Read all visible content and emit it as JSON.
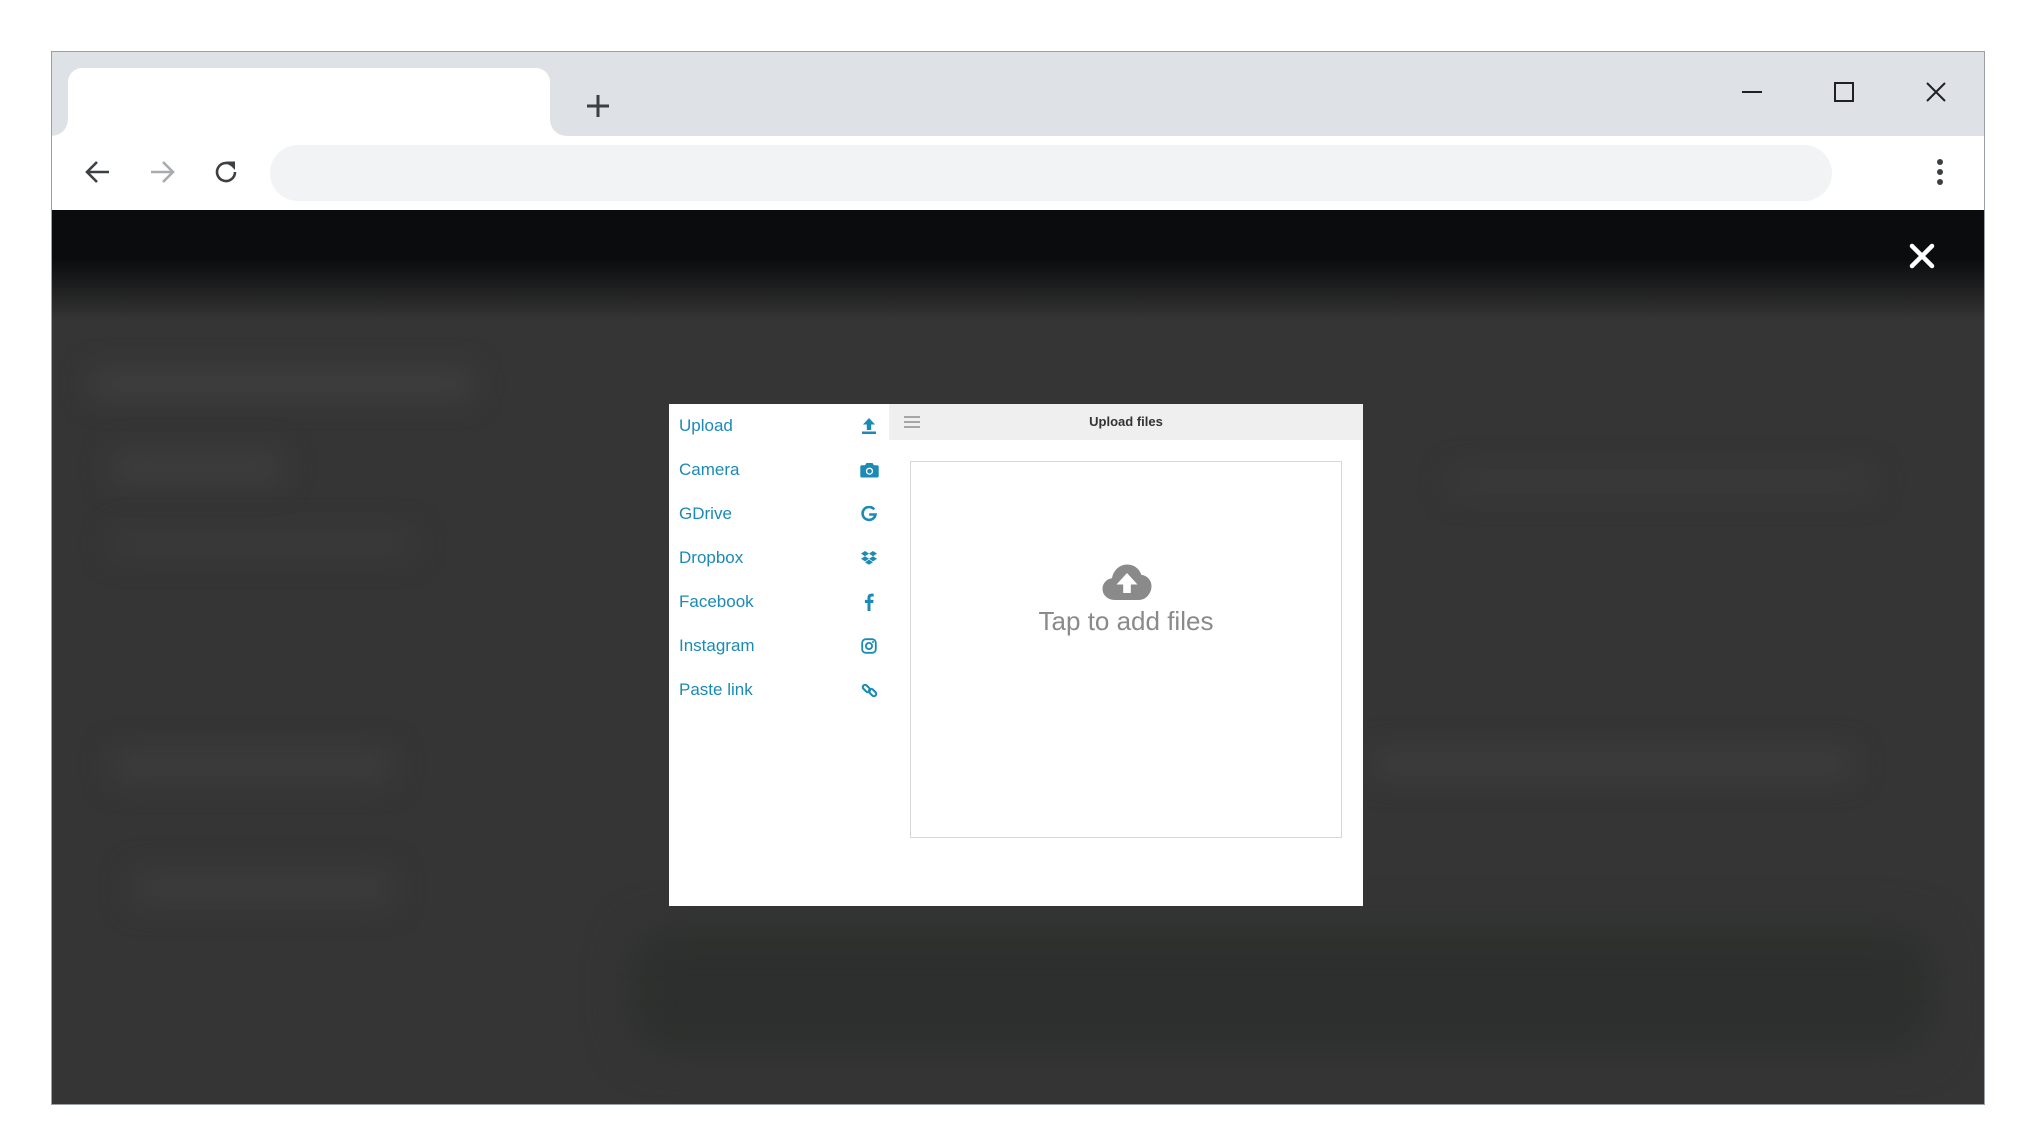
{
  "browser": {
    "tab_title": "",
    "address_value": "",
    "address_placeholder": ""
  },
  "overlay": {
    "close_glyph": "✕"
  },
  "picker": {
    "sources": [
      {
        "label": "Upload",
        "icon": "upload-icon"
      },
      {
        "label": "Camera",
        "icon": "camera-icon"
      },
      {
        "label": "GDrive",
        "icon": "google-icon"
      },
      {
        "label": "Dropbox",
        "icon": "dropbox-icon"
      },
      {
        "label": "Facebook",
        "icon": "facebook-icon"
      },
      {
        "label": "Instagram",
        "icon": "instagram-icon"
      },
      {
        "label": "Paste link",
        "icon": "link-icon"
      }
    ],
    "header_title": "Upload files",
    "dropzone_text": "Tap to add files"
  },
  "colors": {
    "accent": "#1b8ab5",
    "overlay_bg": "#353535",
    "tabstrip_bg": "#dee1e6"
  }
}
